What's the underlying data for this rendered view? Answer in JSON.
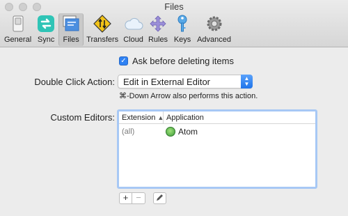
{
  "window": {
    "title": "Files"
  },
  "toolbar": {
    "items": [
      {
        "label": "General",
        "icon": "switch-icon"
      },
      {
        "label": "Sync",
        "icon": "sync-icon"
      },
      {
        "label": "Files",
        "icon": "files-icon",
        "active": true
      },
      {
        "label": "Transfers",
        "icon": "transfers-sign-icon"
      },
      {
        "label": "Cloud",
        "icon": "cloud-icon"
      },
      {
        "label": "Rules",
        "icon": "rules-arrows-icon"
      },
      {
        "label": "Keys",
        "icon": "key-icon"
      },
      {
        "label": "Advanced",
        "icon": "gear-icon"
      }
    ]
  },
  "settings": {
    "ask_before_delete": {
      "label": "Ask before deleting items",
      "checked": true
    },
    "double_click": {
      "label": "Double Click Action:",
      "value": "Edit in External Editor",
      "hint": "⌘-Down Arrow also performs this action."
    },
    "custom_editors": {
      "label": "Custom Editors:",
      "columns": [
        "Extension",
        "Application"
      ],
      "rows": [
        {
          "extension": "(all)",
          "application": "Atom"
        }
      ]
    }
  },
  "buttons": {
    "add": "+",
    "remove": "−"
  },
  "colors": {
    "accent": "#2f82f3",
    "table_focus_border": "#a7c8f5"
  }
}
